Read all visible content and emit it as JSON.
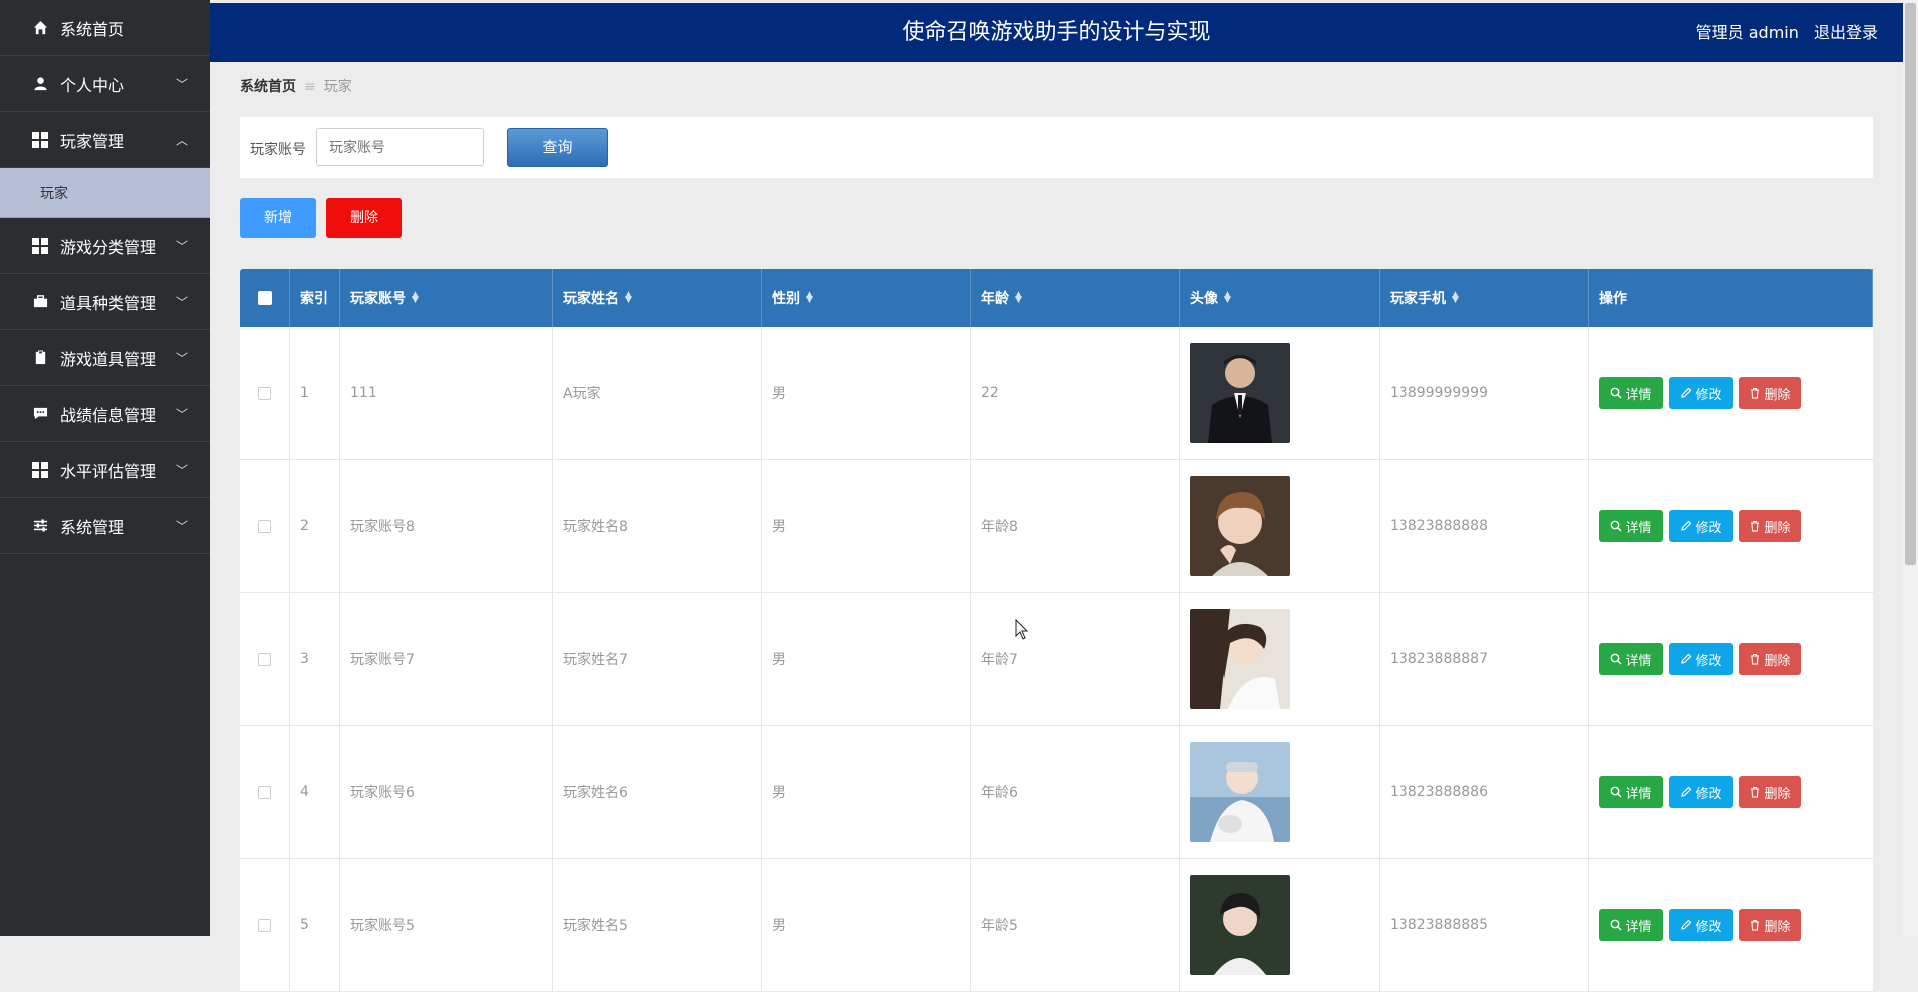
{
  "app": {
    "title": "使命召唤游戏助手的设计与实现"
  },
  "header": {
    "user_label": "管理员 admin",
    "logout": "退出登录"
  },
  "sidebar": {
    "items": [
      {
        "label": "系统首页",
        "icon": "home-icon"
      },
      {
        "label": "个人中心",
        "icon": "user-icon",
        "expandable": true
      },
      {
        "label": "玩家管理",
        "icon": "grid-icon",
        "expanded": true,
        "sub": [
          {
            "label": "玩家",
            "active": true
          }
        ]
      },
      {
        "label": "游戏分类管理",
        "icon": "grid-icon",
        "expandable": true
      },
      {
        "label": "道具种类管理",
        "icon": "briefcase-icon",
        "expandable": true
      },
      {
        "label": "游戏道具管理",
        "icon": "clipboard-icon",
        "expandable": true
      },
      {
        "label": "战绩信息管理",
        "icon": "chat-icon",
        "expandable": true
      },
      {
        "label": "水平评估管理",
        "icon": "grid-icon",
        "expandable": true
      },
      {
        "label": "系统管理",
        "icon": "sliders-icon",
        "expandable": true
      }
    ]
  },
  "breadcrumb": {
    "home": "系统首页",
    "separator": "≡",
    "current": "玩家"
  },
  "search": {
    "label": "玩家账号",
    "placeholder": "玩家账号",
    "button": "查询"
  },
  "actions": {
    "add": "新增",
    "delete": "删除"
  },
  "table": {
    "columns": [
      "索引",
      "玩家账号",
      "玩家姓名",
      "性别",
      "年龄",
      "头像",
      "玩家手机",
      "操作"
    ],
    "row_actions": {
      "detail": "详情",
      "edit": "修改",
      "delete": "删除"
    },
    "rows": [
      {
        "index": "1",
        "account": "111",
        "name": "A玩家",
        "gender": "男",
        "age": "22",
        "phone": "13899999999"
      },
      {
        "index": "2",
        "account": "玩家账号8",
        "name": "玩家姓名8",
        "gender": "男",
        "age": "年龄8",
        "phone": "13823888888"
      },
      {
        "index": "3",
        "account": "玩家账号7",
        "name": "玩家姓名7",
        "gender": "男",
        "age": "年龄7",
        "phone": "13823888887"
      },
      {
        "index": "4",
        "account": "玩家账号6",
        "name": "玩家姓名6",
        "gender": "男",
        "age": "年龄6",
        "phone": "13823888886"
      },
      {
        "index": "5",
        "account": "玩家账号5",
        "name": "玩家姓名5",
        "gender": "男",
        "age": "年龄5",
        "phone": "13823888885"
      }
    ]
  },
  "colors": {
    "header": "#012a7a",
    "sidebar": "#2b2e31",
    "table_header": "#2f74b6",
    "add": "#3e9cff",
    "delete": "#f20d0d",
    "detail": "#28a745",
    "edit": "#0ea5e9",
    "row_delete": "#d9534f"
  }
}
